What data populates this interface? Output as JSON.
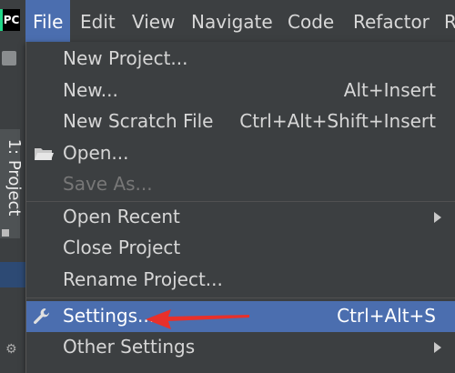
{
  "app_logo": "PC",
  "menubar": {
    "items": [
      {
        "label": "File",
        "active": true
      },
      {
        "label": "Edit"
      },
      {
        "label": "View"
      },
      {
        "label": "Navigate"
      },
      {
        "label": "Code"
      },
      {
        "label": "Refactor"
      },
      {
        "label": "R"
      }
    ]
  },
  "sidebar": {
    "project_tab": "1: Project"
  },
  "file_menu": {
    "items": [
      {
        "label": "New Project...",
        "shortcut": ""
      },
      {
        "label": "New...",
        "shortcut": "Alt+Insert"
      },
      {
        "label": "New Scratch File",
        "shortcut": "Ctrl+Alt+Shift+Insert"
      },
      {
        "label": "Open...",
        "shortcut": "",
        "icon": "folder-icon"
      },
      {
        "label": "Save As...",
        "shortcut": "",
        "disabled": true
      },
      {
        "label": "Open Recent",
        "shortcut": "",
        "submenu": true
      },
      {
        "label": "Close Project",
        "shortcut": ""
      },
      {
        "label": "Rename Project...",
        "shortcut": ""
      },
      {
        "label": "Settings...",
        "shortcut": "Ctrl+Alt+S",
        "icon": "wrench-icon",
        "selected": true
      },
      {
        "label": "Other Settings",
        "shortcut": "",
        "submenu": true
      }
    ]
  },
  "colors": {
    "menu_bg": "#3c3f41",
    "selection": "#4b6eaf",
    "annotation_arrow": "#e8302a"
  }
}
